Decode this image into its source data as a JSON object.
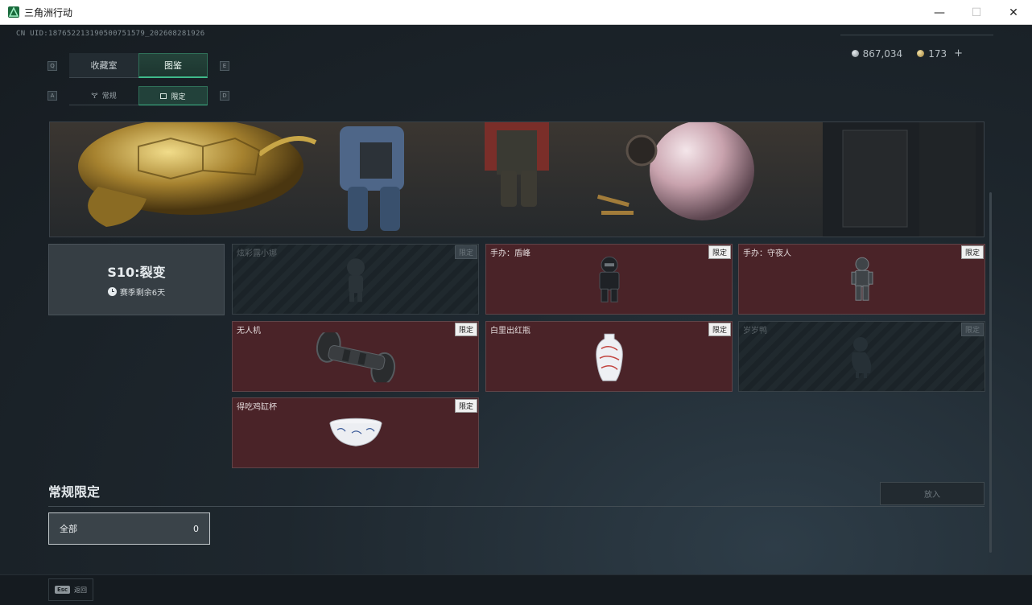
{
  "window": {
    "title": "三角洲行动",
    "controls": {
      "minimize": "—",
      "maximize": "☐",
      "close": "✕"
    }
  },
  "uid": "CN UID:18765221319050075157​9_202608281926",
  "currency": {
    "silver": "867,034",
    "gold": "173",
    "add": "+"
  },
  "tabs": {
    "left_key": "Q",
    "right_key": "E",
    "items": [
      {
        "label": "收藏室",
        "active": false
      },
      {
        "label": "图鉴",
        "active": true
      }
    ]
  },
  "subtabs": {
    "left_key": "A",
    "right_key": "D",
    "items": [
      {
        "label": "常规",
        "active": false
      },
      {
        "label": "限定",
        "active": true
      }
    ]
  },
  "season": {
    "title": "S10:裂变",
    "subtitle": "赛季剩余6天"
  },
  "items": [
    {
      "name": "炫彩露小娜",
      "badge": "限定",
      "locked": true,
      "icon": "figure-icon"
    },
    {
      "name": "手办：盾峰",
      "badge": "限定",
      "locked": false,
      "icon": "armored-figure-icon"
    },
    {
      "name": "手办：守夜人",
      "badge": "限定",
      "locked": false,
      "icon": "soldier-figure-icon"
    },
    {
      "name": "无人机",
      "badge": "限定",
      "locked": false,
      "icon": "drone-icon"
    },
    {
      "name": "白里出红瓶",
      "badge": "限定",
      "locked": false,
      "icon": "vase-icon"
    },
    {
      "name": "岁岁鸭",
      "badge": "限定",
      "locked": true,
      "icon": "duck-icon"
    },
    {
      "name": "得吃鸡缸杯",
      "badge": "限定",
      "locked": false,
      "icon": "bowl-icon"
    }
  ],
  "section": {
    "title": "常规限定",
    "put_button": "放入",
    "filter": {
      "label": "全部",
      "count": "0"
    }
  },
  "footer": {
    "esc_key": "Esc",
    "back_label": "返回"
  },
  "colors": {
    "accent": "#3fb98a",
    "card_unlocked": "#4a2328",
    "background": "#1b2228"
  }
}
